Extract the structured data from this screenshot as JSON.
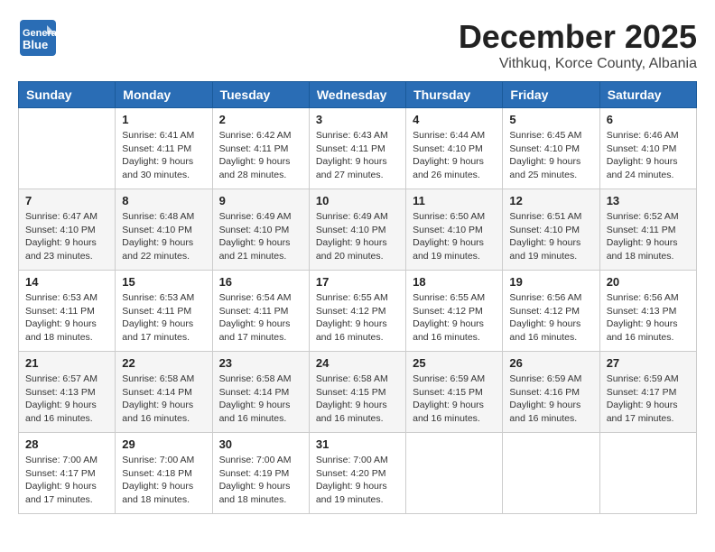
{
  "header": {
    "logo_line1": "General",
    "logo_line2": "Blue",
    "month_title": "December 2025",
    "subtitle": "Vithkuq, Korce County, Albania"
  },
  "weekdays": [
    "Sunday",
    "Monday",
    "Tuesday",
    "Wednesday",
    "Thursday",
    "Friday",
    "Saturday"
  ],
  "weeks": [
    [
      {
        "day": "",
        "info": ""
      },
      {
        "day": "1",
        "info": "Sunrise: 6:41 AM\nSunset: 4:11 PM\nDaylight: 9 hours\nand 30 minutes."
      },
      {
        "day": "2",
        "info": "Sunrise: 6:42 AM\nSunset: 4:11 PM\nDaylight: 9 hours\nand 28 minutes."
      },
      {
        "day": "3",
        "info": "Sunrise: 6:43 AM\nSunset: 4:11 PM\nDaylight: 9 hours\nand 27 minutes."
      },
      {
        "day": "4",
        "info": "Sunrise: 6:44 AM\nSunset: 4:10 PM\nDaylight: 9 hours\nand 26 minutes."
      },
      {
        "day": "5",
        "info": "Sunrise: 6:45 AM\nSunset: 4:10 PM\nDaylight: 9 hours\nand 25 minutes."
      },
      {
        "day": "6",
        "info": "Sunrise: 6:46 AM\nSunset: 4:10 PM\nDaylight: 9 hours\nand 24 minutes."
      }
    ],
    [
      {
        "day": "7",
        "info": "Sunrise: 6:47 AM\nSunset: 4:10 PM\nDaylight: 9 hours\nand 23 minutes."
      },
      {
        "day": "8",
        "info": "Sunrise: 6:48 AM\nSunset: 4:10 PM\nDaylight: 9 hours\nand 22 minutes."
      },
      {
        "day": "9",
        "info": "Sunrise: 6:49 AM\nSunset: 4:10 PM\nDaylight: 9 hours\nand 21 minutes."
      },
      {
        "day": "10",
        "info": "Sunrise: 6:49 AM\nSunset: 4:10 PM\nDaylight: 9 hours\nand 20 minutes."
      },
      {
        "day": "11",
        "info": "Sunrise: 6:50 AM\nSunset: 4:10 PM\nDaylight: 9 hours\nand 19 minutes."
      },
      {
        "day": "12",
        "info": "Sunrise: 6:51 AM\nSunset: 4:10 PM\nDaylight: 9 hours\nand 19 minutes."
      },
      {
        "day": "13",
        "info": "Sunrise: 6:52 AM\nSunset: 4:11 PM\nDaylight: 9 hours\nand 18 minutes."
      }
    ],
    [
      {
        "day": "14",
        "info": "Sunrise: 6:53 AM\nSunset: 4:11 PM\nDaylight: 9 hours\nand 18 minutes."
      },
      {
        "day": "15",
        "info": "Sunrise: 6:53 AM\nSunset: 4:11 PM\nDaylight: 9 hours\nand 17 minutes."
      },
      {
        "day": "16",
        "info": "Sunrise: 6:54 AM\nSunset: 4:11 PM\nDaylight: 9 hours\nand 17 minutes."
      },
      {
        "day": "17",
        "info": "Sunrise: 6:55 AM\nSunset: 4:12 PM\nDaylight: 9 hours\nand 16 minutes."
      },
      {
        "day": "18",
        "info": "Sunrise: 6:55 AM\nSunset: 4:12 PM\nDaylight: 9 hours\nand 16 minutes."
      },
      {
        "day": "19",
        "info": "Sunrise: 6:56 AM\nSunset: 4:12 PM\nDaylight: 9 hours\nand 16 minutes."
      },
      {
        "day": "20",
        "info": "Sunrise: 6:56 AM\nSunset: 4:13 PM\nDaylight: 9 hours\nand 16 minutes."
      }
    ],
    [
      {
        "day": "21",
        "info": "Sunrise: 6:57 AM\nSunset: 4:13 PM\nDaylight: 9 hours\nand 16 minutes."
      },
      {
        "day": "22",
        "info": "Sunrise: 6:58 AM\nSunset: 4:14 PM\nDaylight: 9 hours\nand 16 minutes."
      },
      {
        "day": "23",
        "info": "Sunrise: 6:58 AM\nSunset: 4:14 PM\nDaylight: 9 hours\nand 16 minutes."
      },
      {
        "day": "24",
        "info": "Sunrise: 6:58 AM\nSunset: 4:15 PM\nDaylight: 9 hours\nand 16 minutes."
      },
      {
        "day": "25",
        "info": "Sunrise: 6:59 AM\nSunset: 4:15 PM\nDaylight: 9 hours\nand 16 minutes."
      },
      {
        "day": "26",
        "info": "Sunrise: 6:59 AM\nSunset: 4:16 PM\nDaylight: 9 hours\nand 16 minutes."
      },
      {
        "day": "27",
        "info": "Sunrise: 6:59 AM\nSunset: 4:17 PM\nDaylight: 9 hours\nand 17 minutes."
      }
    ],
    [
      {
        "day": "28",
        "info": "Sunrise: 7:00 AM\nSunset: 4:17 PM\nDaylight: 9 hours\nand 17 minutes."
      },
      {
        "day": "29",
        "info": "Sunrise: 7:00 AM\nSunset: 4:18 PM\nDaylight: 9 hours\nand 18 minutes."
      },
      {
        "day": "30",
        "info": "Sunrise: 7:00 AM\nSunset: 4:19 PM\nDaylight: 9 hours\nand 18 minutes."
      },
      {
        "day": "31",
        "info": "Sunrise: 7:00 AM\nSunset: 4:20 PM\nDaylight: 9 hours\nand 19 minutes."
      },
      {
        "day": "",
        "info": ""
      },
      {
        "day": "",
        "info": ""
      },
      {
        "day": "",
        "info": ""
      }
    ]
  ]
}
